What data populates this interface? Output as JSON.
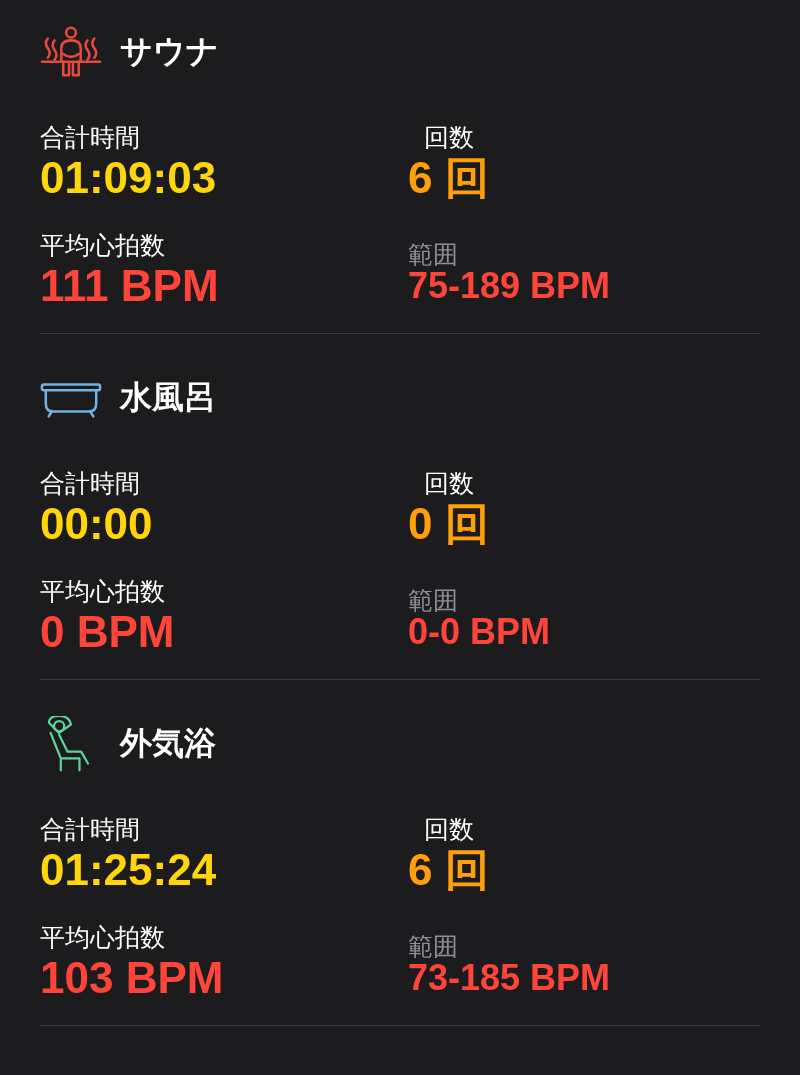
{
  "sections": [
    {
      "title": "サウナ",
      "icon": {
        "kind": "sauna",
        "color": "#e8493c"
      },
      "total_label": "合計時間",
      "total": "01:09:03",
      "count_label": "回数",
      "count": "6 回",
      "hr_label": "平均心拍数",
      "hr": "111 BPM",
      "range_label": "範囲",
      "range": "75-189 BPM"
    },
    {
      "title": "水風呂",
      "icon": {
        "kind": "bath",
        "color": "#6fb3e8"
      },
      "total_label": "合計時間",
      "total": "00:00",
      "count_label": "回数",
      "count": "0 回",
      "hr_label": "平均心拍数",
      "hr": "0 BPM",
      "range_label": "範囲",
      "range": "0-0 BPM"
    },
    {
      "title": "外気浴",
      "icon": {
        "kind": "rest",
        "color": "#5fd39a"
      },
      "total_label": "合計時間",
      "total": "01:25:24",
      "count_label": "回数",
      "count": "6 回",
      "hr_label": "平均心拍数",
      "hr": "103 BPM",
      "range_label": "範囲",
      "range": "73-185 BPM"
    }
  ]
}
